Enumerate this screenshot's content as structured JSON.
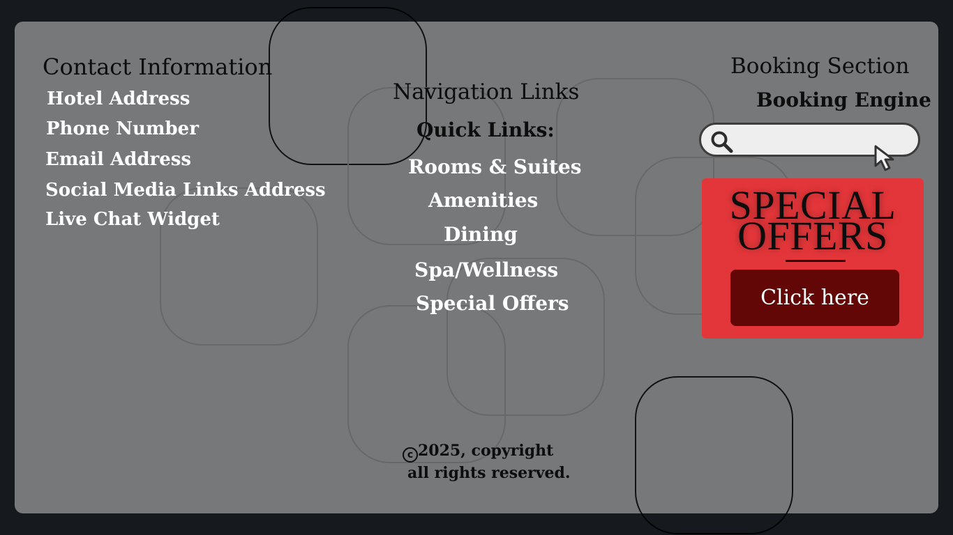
{
  "contact": {
    "heading": "Contact Information",
    "links": [
      "Hotel Address",
      "Phone Number",
      "Email Address",
      "Social Media Links Address",
      "Live Chat Widget"
    ]
  },
  "navigation": {
    "heading": "Navigation Links",
    "quick_links_label": "Quick Links:",
    "links": [
      "Rooms & Suites",
      "Amenities",
      "Dining",
      "Spa/Wellness",
      "Special Offers"
    ]
  },
  "booking": {
    "heading": "Booking Section",
    "engine_label": "Booking Engine",
    "search_value": "",
    "search_icon": "search-icon",
    "cursor_icon": "cursor-arrow-icon"
  },
  "offers": {
    "title_line1": "SPECIAL",
    "title_line2": "OFFERS",
    "button_label": "Click here",
    "panel_color": "#e3363a",
    "button_color": "#620606"
  },
  "footer": {
    "copyright_symbol": "c",
    "copyright_text": "2025, copyright",
    "rights_text": "all rights reserved."
  },
  "colors": {
    "page_background": "#161a1e",
    "panel_background": "#77787a",
    "link_color": "#ffffff",
    "heading_color": "#0d0d0d"
  }
}
